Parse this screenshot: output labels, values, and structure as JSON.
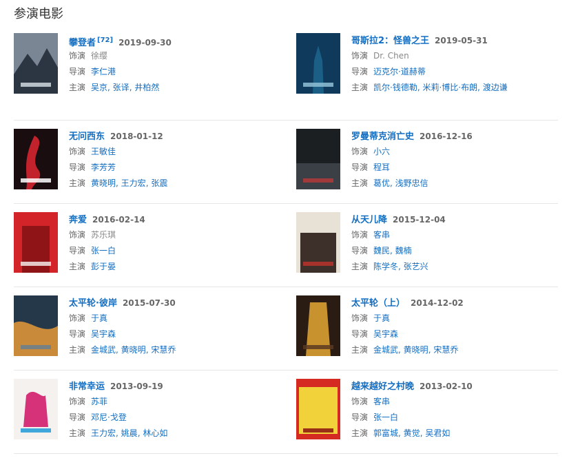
{
  "section_title": "参演电影",
  "movies": [
    {
      "title": "攀登者",
      "ref": "[72]",
      "date": "2019-09-30",
      "role_label": "饰演",
      "role": "徐缨",
      "role_linked": false,
      "director_label": "导演",
      "directors": [
        "李仁港"
      ],
      "cast_label": "主演",
      "cast": [
        "吴京",
        "张译",
        "井柏然"
      ],
      "poster_colors": [
        "#7a8694",
        "#2c3642",
        "#cfd6dd"
      ]
    },
    {
      "title": "哥斯拉2：怪兽之王",
      "ref": "",
      "date": "2019-05-31",
      "role_label": "饰演",
      "role": "Dr. Chen",
      "role_linked": false,
      "director_label": "导演",
      "directors": [
        "迈克尔·道赫蒂"
      ],
      "cast_label": "主演",
      "cast": [
        "凯尔·钱德勒",
        "米莉·博比·布朗",
        "渡边谦"
      ],
      "poster_colors": [
        "#0f3a5c",
        "#1b5f86",
        "#8fc0d6"
      ]
    },
    {
      "title": "无问西东",
      "ref": "",
      "date": "2018-01-12",
      "role_label": "饰演",
      "role": "王敏佳",
      "role_linked": true,
      "director_label": "导演",
      "directors": [
        "李芳芳"
      ],
      "cast_label": "主演",
      "cast": [
        "黄晓明",
        "王力宏",
        "张震"
      ],
      "poster_colors": [
        "#1a0d0f",
        "#c2222c",
        "#ffffff"
      ]
    },
    {
      "title": "罗曼蒂克消亡史",
      "ref": "",
      "date": "2016-12-16",
      "role_label": "饰演",
      "role": "小六",
      "role_linked": true,
      "director_label": "导演",
      "directors": [
        "程耳"
      ],
      "cast_label": "主演",
      "cast": [
        "葛优",
        "浅野忠信"
      ],
      "poster_colors": [
        "#1c1f22",
        "#3b4046",
        "#b33a3a"
      ]
    },
    {
      "title": "奔爱",
      "ref": "",
      "date": "2016-02-14",
      "role_label": "饰演",
      "role": "苏乐琪",
      "role_linked": false,
      "director_label": "导演",
      "directors": [
        "张一白"
      ],
      "cast_label": "主演",
      "cast": [
        "彭于晏"
      ],
      "poster_colors": [
        "#d3242a",
        "#8e1418",
        "#f3e6e6"
      ]
    },
    {
      "title": "从天儿降",
      "ref": "",
      "date": "2015-12-04",
      "role_label": "饰演",
      "role": "客串",
      "role_linked": true,
      "director_label": "导演",
      "directors": [
        "魏民",
        "魏楠"
      ],
      "cast_label": "主演",
      "cast": [
        "陈学冬",
        "张艺兴"
      ],
      "poster_colors": [
        "#e8e2d6",
        "#3d2f2a",
        "#b8322c"
      ]
    },
    {
      "title": "太平轮·彼岸",
      "ref": "",
      "date": "2015-07-30",
      "role_label": "饰演",
      "role": "于真",
      "role_linked": true,
      "director_label": "导演",
      "directors": [
        "吴宇森"
      ],
      "cast_label": "主演",
      "cast": [
        "金城武",
        "黄晓明",
        "宋慧乔"
      ],
      "poster_colors": [
        "#24384a",
        "#c98b3a",
        "#6a7f8f"
      ]
    },
    {
      "title": "太平轮（上）",
      "ref": "",
      "date": "2014-12-02",
      "role_label": "饰演",
      "role": "于真",
      "role_linked": true,
      "director_label": "导演",
      "directors": [
        "吴宇森"
      ],
      "cast_label": "主演",
      "cast": [
        "金城武",
        "黄晓明",
        "宋慧乔"
      ],
      "poster_colors": [
        "#2a1c12",
        "#c8922f",
        "#5a3a22"
      ]
    },
    {
      "title": "非常幸运",
      "ref": "",
      "date": "2013-09-19",
      "role_label": "饰演",
      "role": "苏菲",
      "role_linked": true,
      "director_label": "导演",
      "directors": [
        "邓尼·戈登"
      ],
      "cast_label": "主演",
      "cast": [
        "王力宏",
        "姚晨",
        "林心如"
      ],
      "poster_colors": [
        "#f4f1ee",
        "#d6327a",
        "#1e9ad6"
      ]
    },
    {
      "title": "越来越好之村晚",
      "ref": "",
      "date": "2013-02-10",
      "role_label": "饰演",
      "role": "客串",
      "role_linked": true,
      "director_label": "导演",
      "directors": [
        "张一白"
      ],
      "cast_label": "主演",
      "cast": [
        "郭富城",
        "黄觉",
        "吴君如"
      ],
      "poster_colors": [
        "#d52a22",
        "#f2d23a",
        "#8a1410"
      ]
    }
  ]
}
